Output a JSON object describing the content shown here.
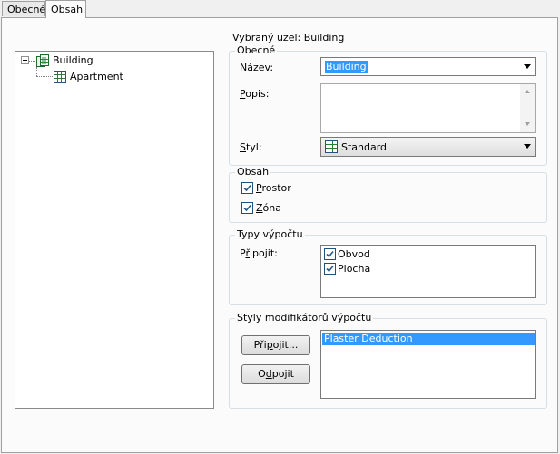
{
  "tabs": [
    {
      "label": "Obecné",
      "active": false
    },
    {
      "label": "Obsah",
      "active": true
    }
  ],
  "tree": {
    "root": {
      "label": "Building",
      "icon": "building-icon",
      "expander": "minus"
    },
    "children": [
      {
        "label": "Apartment",
        "icon": "grid-icon"
      }
    ]
  },
  "selected_node": "Vybraný uzel: Building",
  "general": {
    "legend": "Obecné",
    "name_label": "Název:",
    "name_value": "Building",
    "desc_label": "Popis:",
    "desc_value": "",
    "style_label": "Styl:",
    "style_value": "Standard",
    "style_icon": "grid-icon"
  },
  "content": {
    "legend": "Obsah",
    "space_label": "Prostor",
    "space_checked": true,
    "zone_label": "Zóna",
    "zone_checked": true
  },
  "calc_types": {
    "legend": "Typy výpočtu",
    "attach_label": "Připojit:",
    "items": [
      {
        "label": "Obvod",
        "checked": true
      },
      {
        "label": "Plocha",
        "checked": true
      }
    ]
  },
  "calc_modifiers": {
    "legend": "Styly modifikátorů výpočtu",
    "attach_button": "Připojit...",
    "detach_button": "Odpojit",
    "items": [
      {
        "label": "Plaster Deduction",
        "selected": true
      }
    ]
  },
  "colors": {
    "selection": "#3399ff",
    "check": "#2a5a8a"
  }
}
